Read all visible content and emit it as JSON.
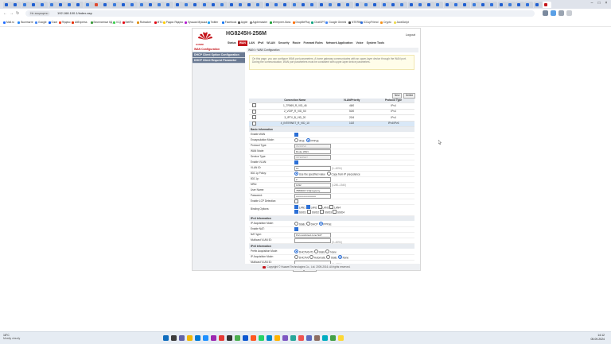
{
  "browser": {
    "tabs": [
      {
        "label": "",
        "color": "#1f5fd1"
      },
      {
        "label": "",
        "color": "#1f5fd1"
      },
      {
        "label": "",
        "color": "#3b7bdc"
      },
      {
        "label": "",
        "color": "#1f5fd1"
      },
      {
        "label": "",
        "color": "#2f6fdb"
      },
      {
        "label": "",
        "color": "#3b7bdc"
      },
      {
        "label": "",
        "color": "#1f5fd1"
      },
      {
        "label": "",
        "color": "#2a6fe0"
      },
      {
        "label": "",
        "color": "#1f5fd1"
      },
      {
        "label": "",
        "color": "#3b7bdc"
      },
      {
        "label": "",
        "color": "#e04a2f"
      },
      {
        "label": "",
        "color": "#1f5fd1"
      },
      {
        "label": "",
        "color": "#3b7bdc"
      },
      {
        "label": "",
        "color": "#1f5fd1"
      },
      {
        "label": "",
        "color": "#2f6fdb"
      },
      {
        "label": "",
        "color": "#3b7bdc"
      },
      {
        "label": "",
        "color": "#1f5fd1"
      },
      {
        "label": "",
        "color": "#3b7bdc"
      },
      {
        "label": "",
        "color": "#2f6fdb"
      },
      {
        "label": "",
        "color": "#1f5fd1"
      },
      {
        "label": "",
        "color": "#3b7bdc"
      },
      {
        "label": "",
        "color": "#1f5fd1"
      },
      {
        "label": "",
        "color": "#2f6fdb"
      },
      {
        "label": "",
        "color": "#1f5fd1"
      },
      {
        "label": "",
        "color": "#3b7bdc"
      },
      {
        "label": "",
        "color": "#1f5fd1"
      },
      {
        "label": "",
        "color": "#2f6fdb"
      },
      {
        "label": "",
        "color": "#1f5fd1"
      },
      {
        "label": "",
        "color": "#3b7bdc"
      },
      {
        "label": "",
        "color": "#1f5fd1"
      },
      {
        "label": "",
        "color": "#2f6fdb"
      },
      {
        "label": "",
        "color": "#1f5fd1"
      },
      {
        "label": "",
        "color": "#3b7bdc"
      },
      {
        "label": "",
        "color": "#1f5fd1"
      },
      {
        "label": "",
        "color": "#2f6fdb"
      },
      {
        "label": "",
        "color": "#1f5fd1"
      },
      {
        "label": "",
        "color": "#3b7bdc"
      },
      {
        "label": "",
        "color": "#1f5fd1"
      },
      {
        "label": "",
        "color": "#2f6fdb"
      },
      {
        "label": "",
        "color": "#1f5fd1"
      },
      {
        "label": "",
        "color": "#3b7bdc"
      },
      {
        "label": "",
        "color": "#1f5fd1"
      },
      {
        "label": "",
        "color": "#2f6fdb"
      },
      {
        "label": "",
        "color": "#1f5fd1"
      },
      {
        "label": "",
        "color": "#3b7bdc"
      },
      {
        "label": "",
        "color": "#1f5fd1"
      },
      {
        "label": "",
        "color": "#2f6fdb"
      },
      {
        "label": "",
        "color": "#1f5fd1"
      },
      {
        "label": "",
        "color": "#3b7bdc"
      },
      {
        "label": "",
        "color": "#1f5fd1"
      },
      {
        "label": "",
        "color": "#2f6fdb"
      },
      {
        "label": "",
        "color": "#1f5fd1"
      },
      {
        "label": "",
        "color": "#3b7bdc"
      },
      {
        "label": "",
        "color": "#1f5fd1"
      },
      {
        "label": "",
        "color": "#2f6fdb"
      },
      {
        "label": "",
        "color": "#1f5fd1"
      },
      {
        "label": "",
        "color": "#3b7bdc"
      },
      {
        "label": "",
        "color": "#1f5fd1"
      },
      {
        "label": "",
        "color": "#2f6fdb"
      },
      {
        "label": "",
        "color": "#1f5fd1"
      },
      {
        "label": "",
        "color": "#c4161c",
        "active": true
      }
    ],
    "address": {
      "warning": "Не защищено",
      "url": "192.168.100.1/index.asp"
    },
    "bookmarks": [
      {
        "label": "Mail.ru",
        "color": "#1e6bff"
      },
      {
        "label": "Вконтакте",
        "color": "#2787f5"
      },
      {
        "label": "Google",
        "color": "#4285f4"
      },
      {
        "label": "Озон",
        "color": "#005bff"
      },
      {
        "label": "Яндекс",
        "color": "#fc3f1d"
      },
      {
        "label": "AliExpress",
        "color": "#e62e04"
      },
      {
        "label": "Бесплатные КД",
        "color": "#3a9a3a"
      },
      {
        "label": "ICQ",
        "color": "#3ccf4e"
      },
      {
        "label": "BetFlix",
        "color": "#e50914"
      },
      {
        "label": "Rutracker",
        "color": "#e08f12"
      },
      {
        "label": "МТС",
        "color": "#e30611"
      },
      {
        "label": "Радио Яндекс",
        "color": "#ffcc00"
      },
      {
        "label": "Лучшая Музыка",
        "color": "#b41ad1"
      },
      {
        "label": "Twitter",
        "color": "#1da1f2"
      },
      {
        "label": "Facebook",
        "color": "#1877f2"
      },
      {
        "label": "Apple",
        "color": "#555555"
      },
      {
        "label": "Applemaster",
        "color": "#888888"
      },
      {
        "label": "Интернет-банк",
        "color": "#21a038"
      },
      {
        "label": "DropMePlay",
        "color": "#ff6f00"
      },
      {
        "label": "ChatGPT",
        "color": "#10a37f"
      },
      {
        "label": "Google Gemini",
        "color": "#4285f4"
      },
      {
        "label": "NTERM",
        "color": "#444444"
      },
      {
        "label": "ICCupFriend",
        "color": "#2f6fdb"
      },
      {
        "label": "Crypto",
        "color": "#f7931a"
      },
      {
        "label": "JavaScript",
        "color": "#f0db4f"
      }
    ]
  },
  "router": {
    "model": "HG8245H-256M",
    "brand": "HUAWEI",
    "logout": "Logout",
    "nav": [
      "Status",
      "WAN",
      "LAN",
      "IPv6",
      "WLAN",
      "Security",
      "Route",
      "Forward Rules",
      "Network Application",
      "Voice",
      "System Tools"
    ],
    "nav_active": 1,
    "side": [
      {
        "label": "WAN Configuration",
        "state": "on"
      },
      {
        "label": "DHCP Client Option Configuration",
        "state": "dk"
      },
      {
        "label": "DHCP Client Request Parameter",
        "state": "dk"
      }
    ],
    "crumb": "WAN > WAN Configuration",
    "note": "On this page, you can configure WAN port parameters. A home gateway communicates with an upper-layer device through the WAN port. During the communication, WAN port parameters must be consistent with upper-layer device parameters.",
    "new_btn": "New",
    "delete_btn": "Delete",
    "table": {
      "headers": [
        "",
        "Connection Name",
        "VLAN/Priority",
        "Protocol Type"
      ],
      "rows": [
        {
          "name": "1_TR069_R_VID_46",
          "vlan": "46/0",
          "proto": "IPv4",
          "sel": false
        },
        {
          "name": "2_VOIP_R_VID_50",
          "vlan": "50/0",
          "proto": "IPv4",
          "sel": false
        },
        {
          "name": "3_IPTV_B_VID_20",
          "vlan": "20/4",
          "proto": "IPv4",
          "sel": false
        },
        {
          "name": "4_INTERNET_R_VID_10",
          "vlan": "10/2",
          "proto": "IPv4/IPv6",
          "sel": true
        }
      ]
    },
    "basic_title": "Basic Information",
    "enable_wan": "Enable WAN",
    "encap_label": "Encapsulation Mode:",
    "encap_opt1": "IPoE",
    "encap_opt2": "PPPoE",
    "proto_label": "Protocol Type:",
    "proto_value": "IPv4/IPv6",
    "workmode_label": "WAN Mode:",
    "workmode_value": "Route WAN",
    "service_label": "Service Type:",
    "service_value": "INTERNET",
    "enable_vlan": "Enable VLAN:",
    "vlanid_label": "VLAN ID:",
    "vlanid_value": "10",
    "vlanid_hint": "(1–4094)",
    "p8021_label": "802.1p Policy:",
    "p8021_opt1": "Use the specified value",
    "p8021_opt2": "Copy from IP precedence",
    "p8021v_label": "802.1p:",
    "p8021v_value": "2",
    "mru_label": "MRU:",
    "mru_value": "1492",
    "mru_hint": "(1280–1540)",
    "user_label": "User Name:",
    "user_value": "7880901717@mgts.by",
    "pass_label": "Password:",
    "pass_value": "••••••••••••••••••••••••",
    "lcp_label": "Enable LCP Detection:",
    "binding_label": "Binding Options:",
    "bind_row1": [
      "LAN1",
      "LAN2",
      "LAN3",
      "LAN4"
    ],
    "bind_row2": [
      "SSID1",
      "SSID2",
      "SSID3",
      "SSID4"
    ],
    "ipv4_title": "IPv4 Information",
    "ipacq_label": "IP Acquisition Mode:",
    "ipacq_opts": [
      "Static",
      "DHCP",
      "PPPoE"
    ],
    "nat_enable": "Enable NAT:",
    "nattype_label": "NAT type:",
    "nattype_value": "Port-restricted cone NAT",
    "mcast_label": "Multicast VLAN ID:",
    "mcast_hint": "(0–4094)",
    "ipv6_title": "IPv6 Information",
    "prefix_label": "Prefix Acquisition Mode:",
    "prefix_opts": [
      "DHCPv6-PD",
      "Static",
      "None"
    ],
    "ip6_label": "IP Acquisition Mode:",
    "ip6_opts": [
      "DHCPv6",
      "Automatic",
      "Static",
      "None"
    ],
    "mcast6_label": "Multicast VLAN ID:",
    "mcast6_hint": "(0–4094)",
    "apply": "Apply",
    "cancel": "Cancel",
    "copyright": "Copyright © Huawei Technologies Co., Ltd. 2009-2016. All rights reserved."
  },
  "taskbar": {
    "weather_temp": "18°C",
    "weather_desc": "Mostly cloudy",
    "time": "14:12",
    "date": "05.09.2024",
    "icons": [
      {
        "color": "#0f6cbd"
      },
      {
        "color": "#3c3c3c"
      },
      {
        "color": "#6264a7"
      },
      {
        "color": "#f2b705"
      },
      {
        "color": "#0078d4"
      },
      {
        "color": "#1e90ff"
      },
      {
        "color": "#9c27b0"
      },
      {
        "color": "#e53935"
      },
      {
        "color": "#333333"
      },
      {
        "color": "#4caf50"
      },
      {
        "color": "#0b57d0"
      },
      {
        "color": "#ff5722"
      },
      {
        "color": "#25d366"
      },
      {
        "color": "#0088cc"
      },
      {
        "color": "#ffb300"
      },
      {
        "color": "#7e57c2"
      },
      {
        "color": "#26a69a"
      },
      {
        "color": "#ef5350"
      },
      {
        "color": "#5c6bc0"
      },
      {
        "color": "#8d6e63"
      },
      {
        "color": "#00acc1"
      },
      {
        "color": "#43a047"
      },
      {
        "color": "#fdd835"
      }
    ]
  }
}
